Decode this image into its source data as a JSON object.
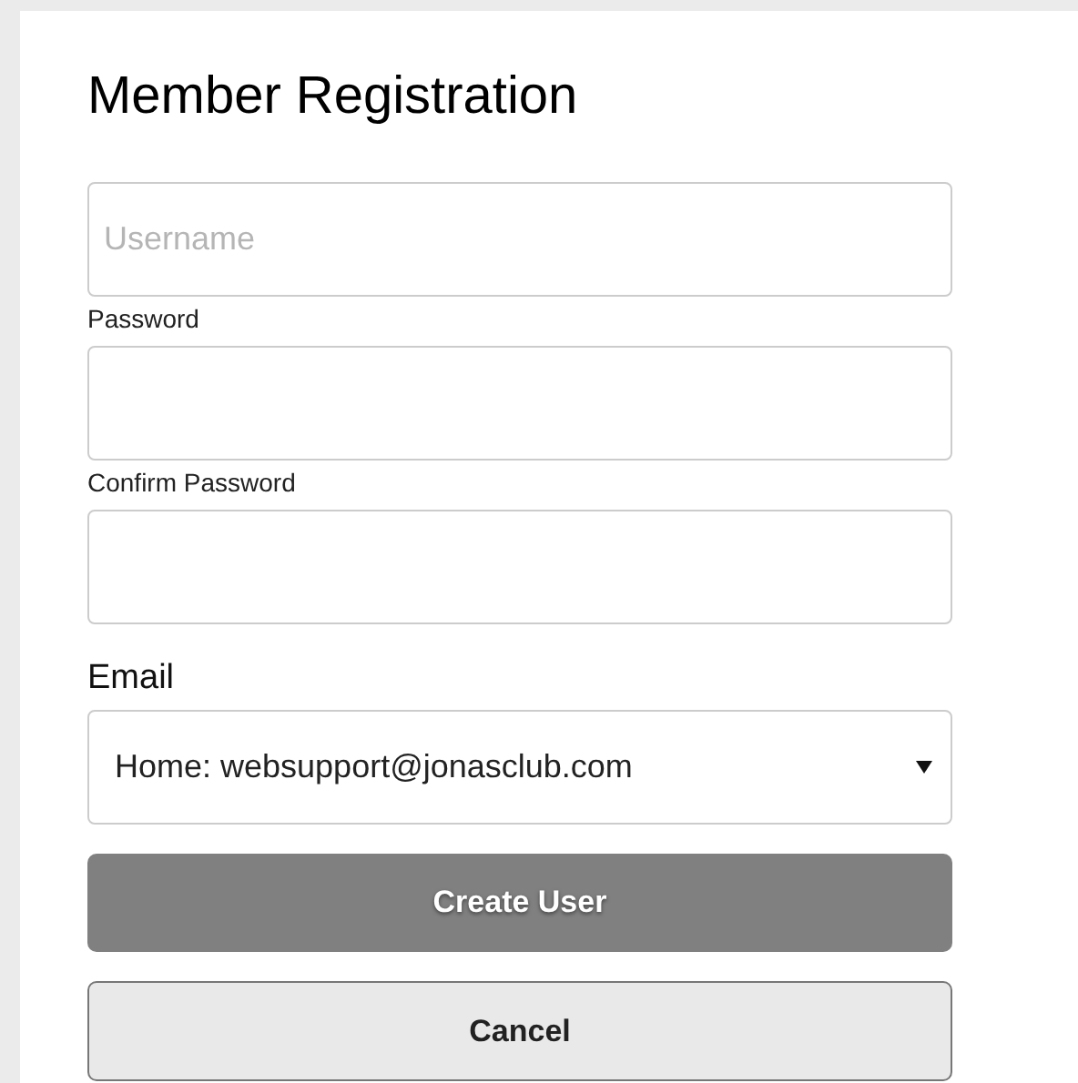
{
  "title": "Member Registration",
  "fields": [
    {
      "placeholder": "Username"
    },
    {
      "label": "Password"
    },
    {
      "label": "Confirm Password"
    }
  ],
  "email": {
    "label": "Email",
    "value": "Home: websupport@jonasclub.com"
  },
  "buttons": [
    {
      "label": "Create User",
      "kind": "primary"
    },
    {
      "label": "Cancel",
      "kind": "secondary"
    }
  ]
}
